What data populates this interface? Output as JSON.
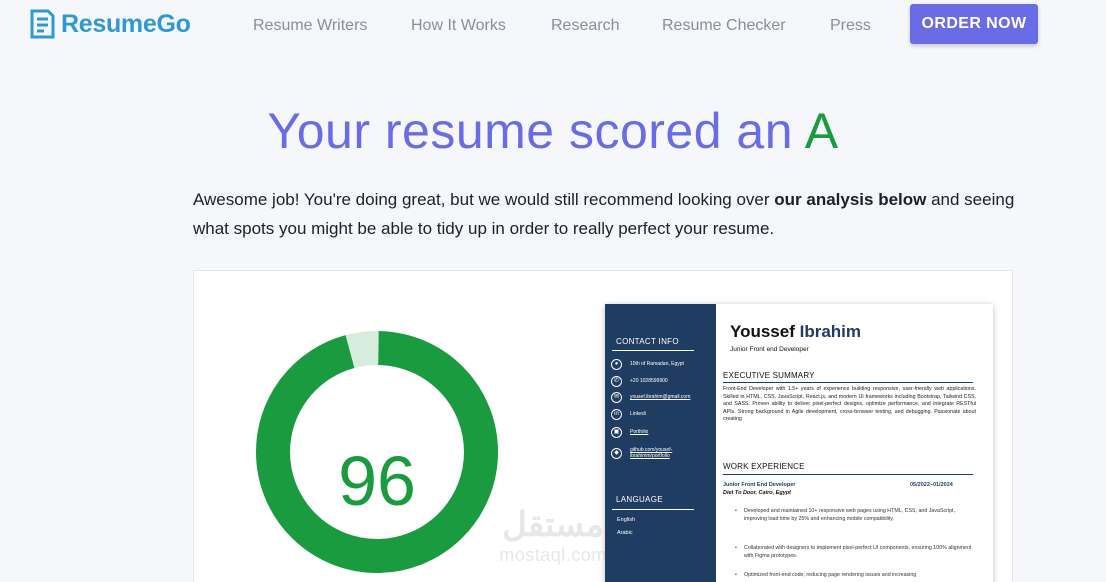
{
  "header": {
    "logo_text": "ResumeGo",
    "nav": [
      "Resume Writers",
      "How It Works",
      "Research",
      "Resume Checker",
      "Press"
    ],
    "order_label": "ORDER NOW"
  },
  "result": {
    "title_prefix": "Your resume scored an",
    "grade": "A",
    "intro_start": "Awesome job! You're doing great, but we would still recommend looking over ",
    "intro_bold": "our analysis below",
    "intro_end": " and seeing what spots you might be able to tidy up in order to really perfect your resume.",
    "score": 96,
    "score_max": 100
  },
  "colors": {
    "accent": "#6a6ce6",
    "grade_green": "#1a9b3f",
    "ring_remaining": "#d6eddd",
    "resume_sidebar": "#1f3d63",
    "logo_blue": "#2f99d4"
  },
  "resume": {
    "first_name": "Youssef",
    "last_name": "Ibrahim",
    "role": "Junior Front end Developer",
    "contact_heading": "CONTACT INFO",
    "contacts": [
      {
        "icon": "location-icon",
        "text": "10th of Ramadan, Egypt"
      },
      {
        "icon": "phone-icon",
        "text": "+20 1028599900"
      },
      {
        "icon": "email-icon",
        "text": "yousef.ibrahim@gmail.com"
      },
      {
        "icon": "linkedin-icon",
        "text": "Linkedi"
      },
      {
        "icon": "portfolio-icon",
        "text": "Portfolio"
      },
      {
        "icon": "github-icon",
        "text": "github.com/yousef-ibrahimm/portfolio"
      }
    ],
    "language_heading": "LANGUAGE",
    "languages": [
      "English",
      "Arabic"
    ],
    "summary_heading": "EXECUTIVE SUMMARY",
    "summary": "Front-End Developer with 1.5+ years of experience building responsive, user-friendly web applications. Skilled in HTML, CSS, JavaScript, React.js, and modern UI frameworks including Bootstrap, Tailwind CSS, and SASS. Proven ability to deliver pixel-perfect designs, optimize performance, and integrate RESTful APIs. Strong background in Agile development, cross-browser testing, and debugging. Passionate about creating",
    "experience_heading": "WORK EXPERIENCE",
    "job_title": "Junior Front End Developer",
    "job_dates": "05/2022–01/2024",
    "job_company": "Diet To Door, Cairo, Egypt",
    "bullets": [
      "Developed and maintained 10+ responsive web pages using HTML, CSS, and JavaScript, improving load time by 25% and enhancing mobile compatibility.",
      "Collaborated with designers to implement pixel-perfect UI components, ensuring 100% alignment with Figma prototypes.",
      "Optimized front-end code, reducing page rendering issues and increasing"
    ]
  },
  "watermark": {
    "arabic": "مستقل",
    "latin": "mostaql.com"
  }
}
